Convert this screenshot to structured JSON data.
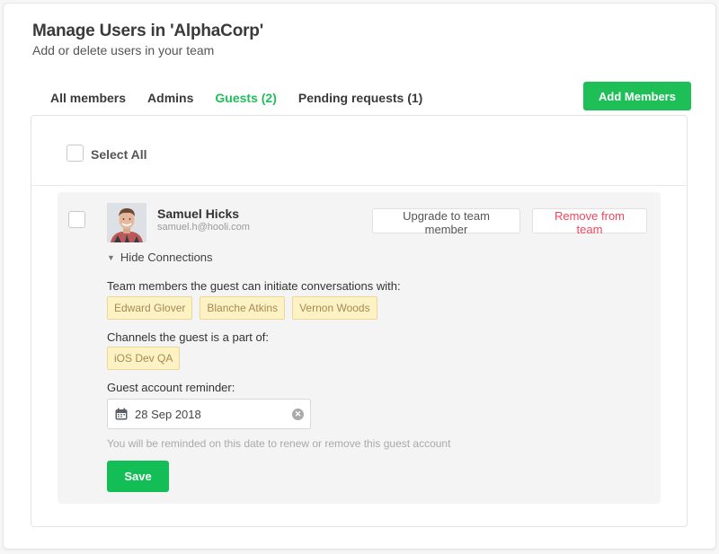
{
  "header": {
    "title": "Manage Users in 'AlphaCorp'",
    "subtitle": "Add or delete users in your team"
  },
  "tabs": [
    {
      "label": "All members",
      "active": false
    },
    {
      "label": "Admins",
      "active": false
    },
    {
      "label": "Guests (2)",
      "active": true
    },
    {
      "label": "Pending requests (1)",
      "active": false
    }
  ],
  "actions": {
    "add_members_label": "Add Members"
  },
  "list": {
    "select_all_label": "Select All",
    "select_all_checked": false
  },
  "user": {
    "name": "Samuel Hicks",
    "email": "samuel.h@hooli.com",
    "checked": false,
    "upgrade_label": "Upgrade to team member",
    "remove_label": "Remove from team",
    "toggle_icon": "triangle-down-icon",
    "toggle_label": "Hide Connections",
    "team_members_label": "Team members the guest can initiate conversations with:",
    "team_members": [
      "Edward Glover",
      "Blanche Atkins",
      "Vernon Woods"
    ],
    "channels_label": "Channels the guest is a part of:",
    "channels": [
      "iOS Dev QA"
    ],
    "reminder_label": "Guest account reminder:",
    "reminder_date": "28 Sep 2018",
    "reminder_hint": "You will be reminded on this date to renew or remove this guest account",
    "save_label": "Save"
  },
  "colors": {
    "accent_green": "#1dbf56",
    "danger_red": "#f0465a",
    "chip_bg": "#fdf2c4",
    "chip_text": "#a68a55"
  }
}
